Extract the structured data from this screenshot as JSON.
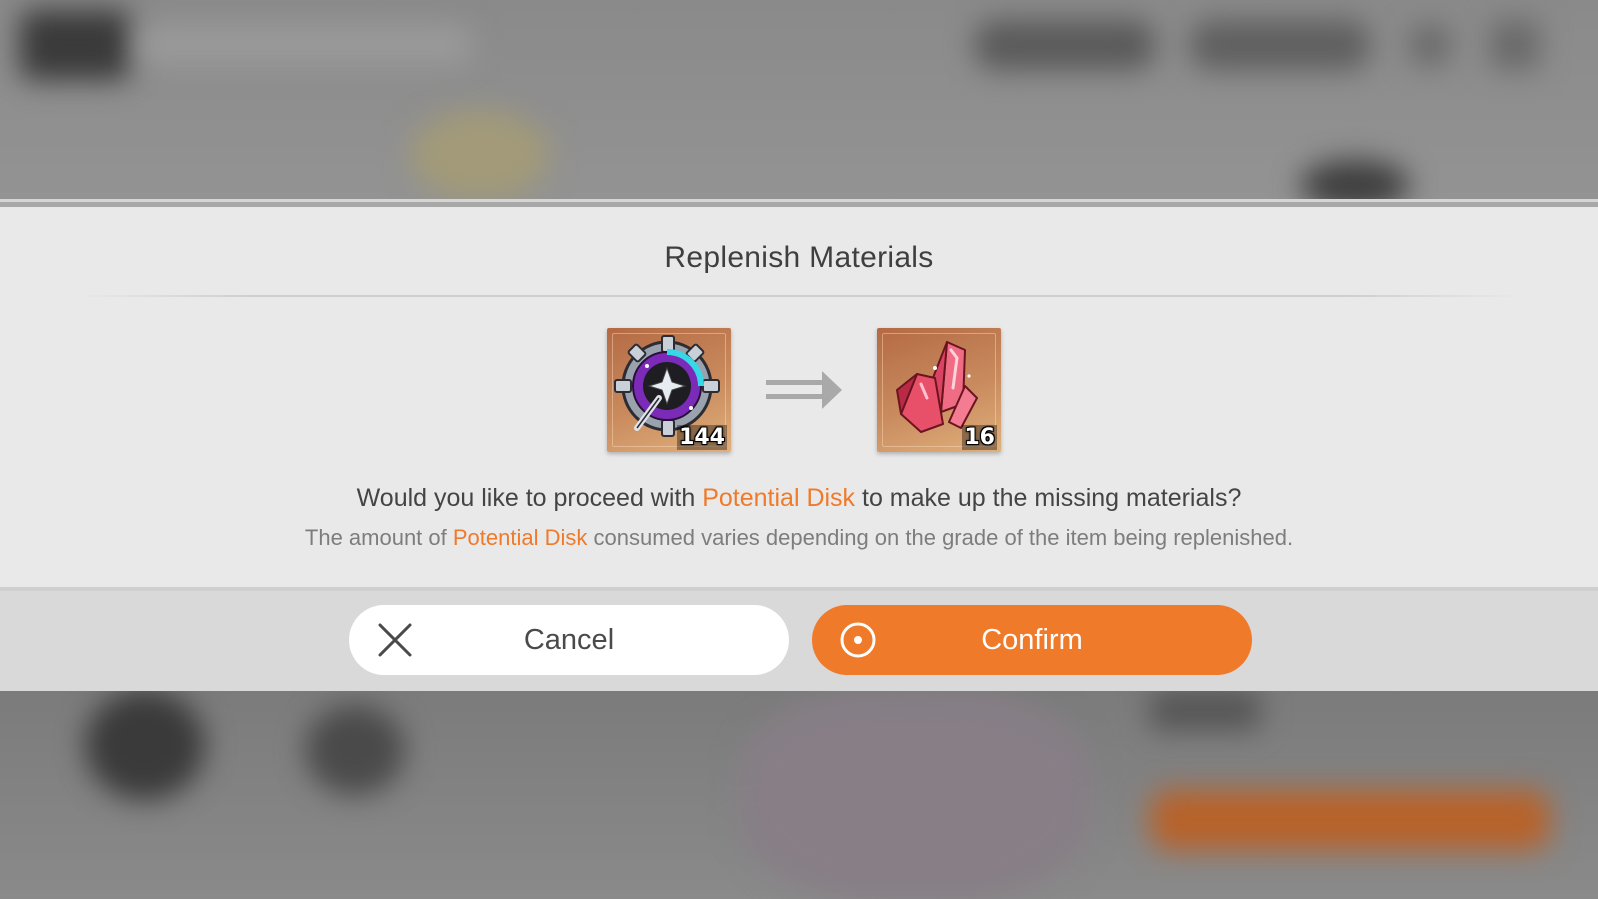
{
  "dialog": {
    "title": "Replenish Materials",
    "source_item": {
      "icon": "potential-disk-icon",
      "quantity": "144"
    },
    "target_item": {
      "icon": "red-crystal-icon",
      "quantity": "16"
    },
    "arrow_icon": "double-arrow-right-icon",
    "message": {
      "before": "Would you like to proceed with ",
      "highlight": "Potential Disk",
      "after": " to make up the missing materials?"
    },
    "note": {
      "before": "The amount of ",
      "highlight": "Potential Disk",
      "after": " consumed varies depending on the grade of the item being replenished."
    }
  },
  "buttons": {
    "cancel_label": "Cancel",
    "cancel_icon": "close-x-icon",
    "confirm_label": "Confirm",
    "confirm_icon": "circle-dot-icon"
  },
  "colors": {
    "accent": "#ef7a2a",
    "dialog_bg": "#e9e9e9",
    "item_frame": "#c98b5e"
  }
}
